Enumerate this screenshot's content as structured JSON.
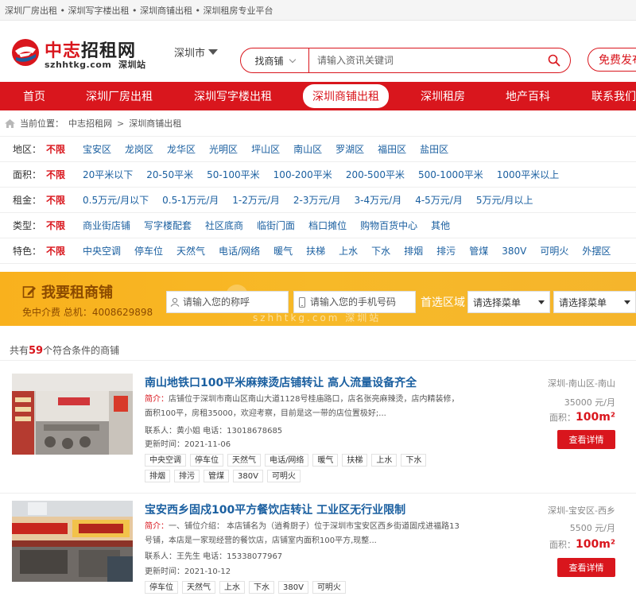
{
  "topbar": {
    "text": "深圳厂房出租 • 深圳写字楼出租 • 深圳商铺出租 • 深圳租房专业平台"
  },
  "logo": {
    "name_part1": "中志",
    "name_part2": "招租网",
    "domain": "szhhtkg.com",
    "station": "深圳站"
  },
  "city": {
    "label": "深圳市"
  },
  "search": {
    "type_label": "找商铺",
    "placeholder": "请输入资讯关键词"
  },
  "free_button": {
    "label": "免费发布"
  },
  "nav": [
    {
      "label": "首页",
      "active": false
    },
    {
      "label": "深圳厂房出租",
      "active": false
    },
    {
      "label": "深圳写字楼出租",
      "active": false
    },
    {
      "label": "深圳商铺出租",
      "active": true
    },
    {
      "label": "深圳租房",
      "active": false
    },
    {
      "label": "地产百科",
      "active": false
    },
    {
      "label": "联系我们",
      "active": false
    }
  ],
  "breadcrumb": {
    "prefix": "当前位置：",
    "home": "中志招租网",
    "separator": ">",
    "current": "深圳商铺出租"
  },
  "filters": [
    {
      "label": "地区：",
      "all": "不限",
      "options": [
        "宝安区",
        "龙岗区",
        "龙华区",
        "光明区",
        "坪山区",
        "南山区",
        "罗湖区",
        "福田区",
        "盐田区"
      ]
    },
    {
      "label": "面积：",
      "all": "不限",
      "options": [
        "20平米以下",
        "20-50平米",
        "50-100平米",
        "100-200平米",
        "200-500平米",
        "500-1000平米",
        "1000平米以上"
      ]
    },
    {
      "label": "租金：",
      "all": "不限",
      "options": [
        "0.5万元/月以下",
        "0.5-1万元/月",
        "1-2万元/月",
        "2-3万元/月",
        "3-4万元/月",
        "4-5万元/月",
        "5万元/月以上"
      ]
    },
    {
      "label": "类型：",
      "all": "不限",
      "options": [
        "商业街店铺",
        "写字楼配套",
        "社区底商",
        "临街门面",
        "档口摊位",
        "购物百货中心",
        "其他"
      ]
    },
    {
      "label": "特色：",
      "all": "不限",
      "options": [
        "中央空调",
        "停车位",
        "天然气",
        "电话/网络",
        "暖气",
        "扶梯",
        "上水",
        "下水",
        "排烟",
        "排污",
        "管煤",
        "380V",
        "可明火",
        "外摆区"
      ]
    }
  ],
  "banner": {
    "title": "我要租商铺",
    "subtitle": "免中介费 总机：4008629898",
    "name_placeholder": "请输入您的称呼",
    "phone_placeholder": "请输入您的手机号码",
    "region_label": "首选区域",
    "select1": "请选择菜单",
    "select2": "请选择菜单",
    "watermark_domain": "szhhtkg.com 深圳站"
  },
  "results": {
    "prefix": "共有",
    "count": "59",
    "suffix": "个符合条件的商铺"
  },
  "listings": [
    {
      "title": "南山地铁口100平米麻辣烫店铺转让 高人流量设备齐全",
      "desc_label": "简介：",
      "desc": "店铺位于深圳市南山区南山大道1128号桂庙路口，店名张亮麻辣烫，店内精装修，面积100平，房租35000，欢迎考察，目前是这一带的店位置极好;...",
      "contact": "联系人：黄小姐 电话：13018678685",
      "updated": "更新时间：2021-11-06",
      "tags": [
        "中央空调",
        "停车位",
        "天然气",
        "电话/网络",
        "暖气",
        "扶梯",
        "上水",
        "下水",
        "排烟",
        "排污",
        "管煤",
        "380V",
        "可明火"
      ],
      "location": "深圳-南山区-南山",
      "price": "35000 元/月",
      "area_label": "面积：",
      "area": "100m²",
      "button": "查看详情"
    },
    {
      "title": "宝安西乡固戍100平方餐饮店转让 工业区无行业限制",
      "desc_label": "简介：",
      "desc": "一、铺位介绍： 本店铺名为（逍肴厨子）位于深圳市宝安区西乡街道固戍进福路13号铺，本店是一家现经营的餐饮店，店铺室内面积100平方,现整...",
      "contact": "联系人：王先生 电话：15338077967",
      "updated": "更新时间：2021-10-12",
      "tags": [
        "停车位",
        "天然气",
        "上水",
        "下水",
        "380V",
        "可明火"
      ],
      "location": "深圳-宝安区-西乡",
      "price": "5500 元/月",
      "area_label": "面积：",
      "area": "100m²",
      "button": "查看详情"
    }
  ],
  "colors": {
    "brand": "#d9161d",
    "link": "#1a5fa0",
    "banner": "#f9b11d"
  }
}
